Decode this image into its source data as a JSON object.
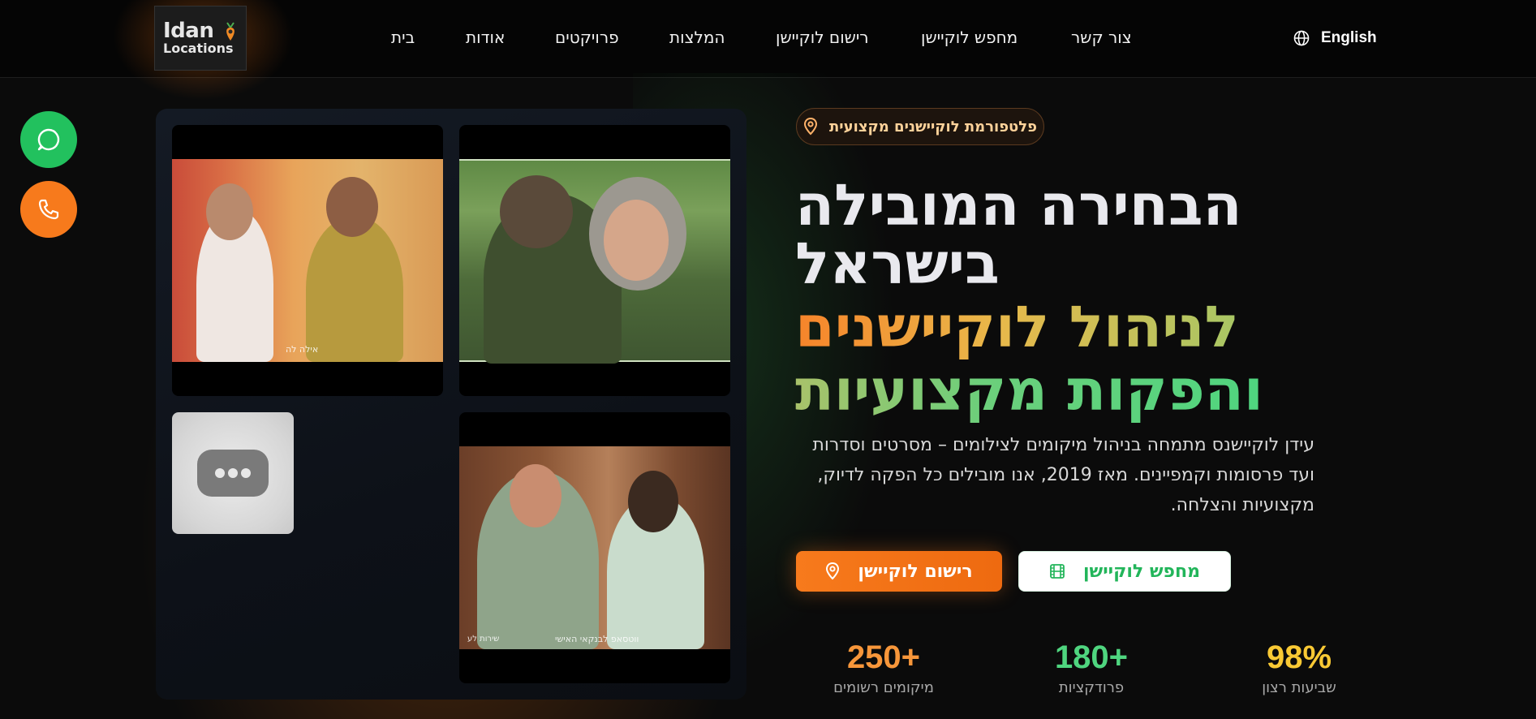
{
  "header": {
    "logo": {
      "line1": "Idan",
      "line2": "Locations"
    },
    "nav": [
      "בית",
      "אודות",
      "פרויקטים",
      "המלצות",
      "רישום לוקיישן",
      "מחפש לוקיישן",
      "צור קשר"
    ],
    "language_label": "English"
  },
  "floating_buttons": {
    "whatsapp_icon": "whatsapp-icon",
    "phone_icon": "phone-icon"
  },
  "videos": {
    "v1_caption": "אילה לה",
    "v3_caption": "ווטסאפ לבנקאי האישי",
    "v3_caption_small": "שירות לע"
  },
  "hero": {
    "badge": "פלטפורמת לוקיישנים מקצועית",
    "headline": [
      "הבחירה המובילה",
      "בישראל",
      "לניהול לוקיישנים",
      "והפקות מקצועיות"
    ],
    "paragraph": [
      "עידן לוקיישנס מתמחה בניהול מיקומים לצילומים – מסרטים וסדרות",
      "ועד פרסומות וקמפיינים. מאז 2019, אנו מובילים כל הפקה לדיוק,",
      "מקצועיות והצלחה."
    ],
    "primary_button": "רישום לוקיישן",
    "secondary_button": "מחפש לוקיישן"
  },
  "stats": [
    {
      "value": "250+",
      "label": "מיקומים רשומים",
      "color": "#f7963a"
    },
    {
      "value": "180+",
      "label": "פרודקציות",
      "color": "#4fd57f"
    },
    {
      "value": "98%",
      "label": "שביעות רצון",
      "color": "#f9c934"
    }
  ],
  "colors": {
    "accent_orange": "#f77a1c",
    "accent_green": "#22c15e",
    "background": "#0b0b0b"
  }
}
